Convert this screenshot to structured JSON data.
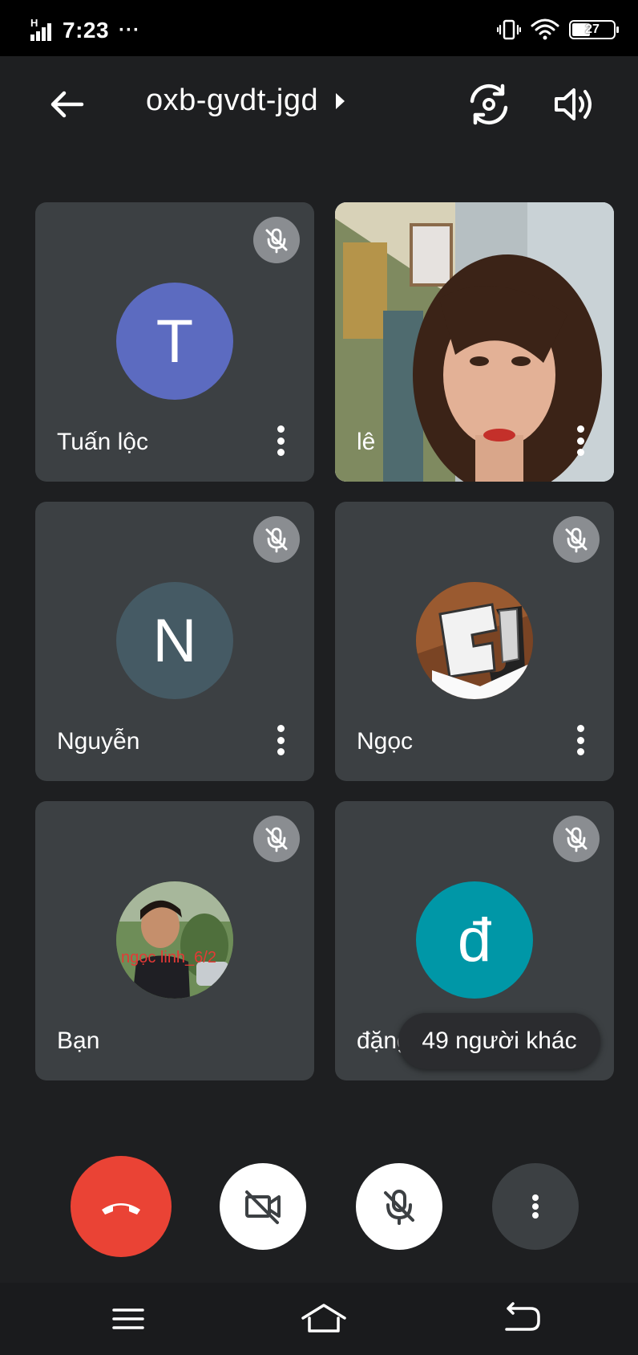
{
  "status_bar": {
    "network": "H",
    "time": "7:23",
    "more": "···",
    "battery": "27"
  },
  "header": {
    "meeting_code": "oxb-gvdt-jgd"
  },
  "participants": [
    {
      "name": "Tuấn lộc",
      "initial": "T",
      "avatar_color": "#5c6bc0",
      "muted": true
    },
    {
      "name": "lê",
      "video": true,
      "muted": false
    },
    {
      "name": "Nguyễn",
      "initial": "N",
      "avatar_color": "#455a64",
      "muted": true
    },
    {
      "name": "Ngọc",
      "avatar": "photo-gj",
      "muted": true
    },
    {
      "name": "Bạn",
      "avatar": "photo-boy",
      "avatar_text": "ngọc linh_6/2",
      "muted": true
    },
    {
      "name": "đặng",
      "initial": "đ",
      "avatar_color": "#0097a7",
      "muted": true
    }
  ],
  "others_label": "49 người khác",
  "colors": {
    "background": "#1e1f21",
    "tile": "#3c4043",
    "end_call": "#ea4335"
  }
}
